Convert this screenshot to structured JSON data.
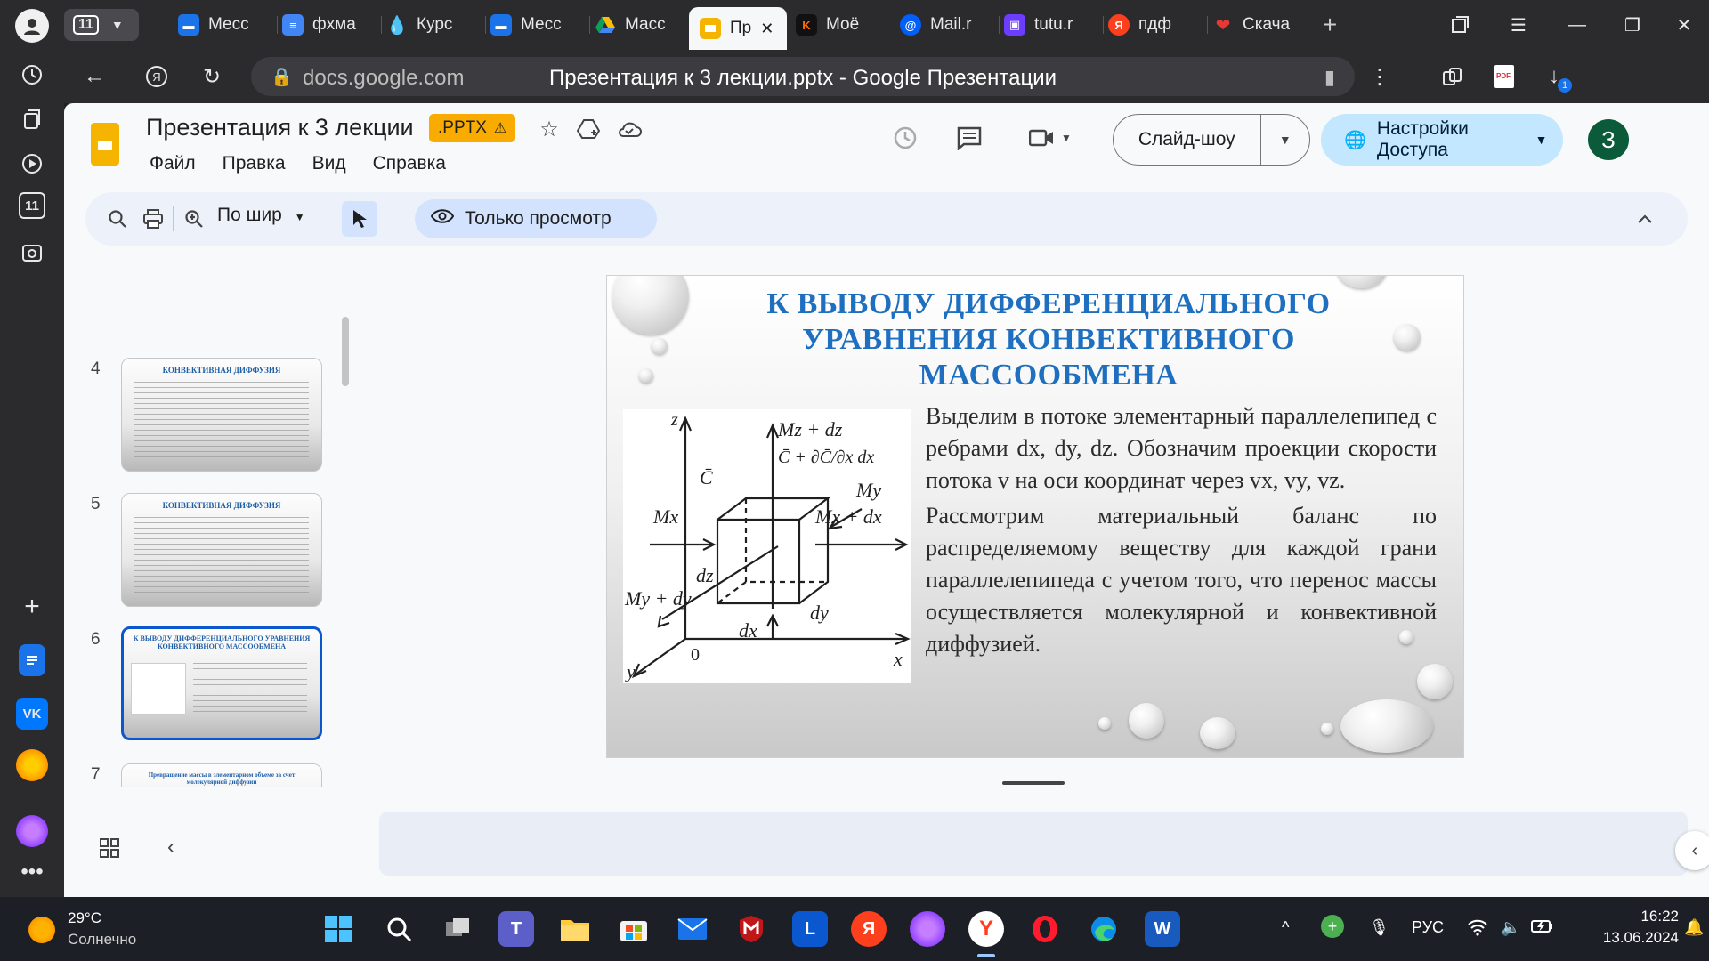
{
  "browser": {
    "tab_count": "11",
    "tabs": [
      {
        "label": "Месс",
        "icon": "messenger-icon",
        "color": "#1a73e8"
      },
      {
        "label": "фхма",
        "icon": "docs-icon",
        "color": "#4285f4"
      },
      {
        "label": "Курс",
        "icon": "drop-icon",
        "color": "#3d5afe"
      },
      {
        "label": "Месс",
        "icon": "messenger-icon",
        "color": "#1a73e8"
      },
      {
        "label": "Масс",
        "icon": "drive-icon",
        "color": "#0f9d58"
      },
      {
        "label": "Пр",
        "icon": "slides-icon",
        "color": "#f4b400"
      },
      {
        "label": "Моё",
        "icon": "k-icon",
        "color": "#ff6d00"
      },
      {
        "label": "Mail.r",
        "icon": "mail-icon",
        "color": "#005ff9"
      },
      {
        "label": "tutu.r",
        "icon": "tutu-icon",
        "color": "#6c3cff"
      },
      {
        "label": "пдф",
        "icon": "yandex-icon",
        "color": "#fc3f1d"
      },
      {
        "label": "Скача",
        "icon": "heart-icon",
        "color": "#e53935"
      }
    ],
    "url": "docs.google.com",
    "page_title": "Презентация к 3 лекции.pptx - Google Презентации",
    "download_badge": "1"
  },
  "docs": {
    "title": "Презентация к 3 лекции",
    "badge": ".PPTX",
    "menu": [
      "Файл",
      "Правка",
      "Вид",
      "Справка"
    ],
    "slideshow_label": "Слайд-шоу",
    "share_label": "Настройки Доступа",
    "account_initial": "З",
    "zoom_label": "По шир",
    "view_only_label": "Только просмотр"
  },
  "filmstrip": [
    {
      "num": "4",
      "title": "КОНВЕКТИВНАЯ ДИФФУЗИЯ",
      "selected": false
    },
    {
      "num": "5",
      "title": "КОНВЕКТИВНАЯ ДИФФУЗИЯ",
      "selected": false
    },
    {
      "num": "6",
      "title": "К ВЫВОДУ ДИФФЕРЕНЦИАЛЬНОГО УРАВНЕНИЯ КОНВЕКТИВНОГО МАССООБМЕНА",
      "selected": true
    },
    {
      "num": "7",
      "title": "Превращение массы в элементарном объеме за счет молекулярной диффузии",
      "selected": false
    }
  ],
  "slide": {
    "title": "К ВЫВОДУ ДИФФЕРЕНЦИАЛЬНОГО УРАВНЕНИЯ КОНВЕКТИВНОГО МАССООБМЕНА",
    "p1": "Выделим в потоке элементарный параллелепипед с ребрами dx, dy, dz. Обозначим проекции скорости потока v на оси координат через vx, vy, vz.",
    "p2": "Рассмотрим материальный баланс по распределяемому веществу для каждой грани параллелепипеда с учетом того, что перенос массы осуществляется молекулярной и конвективной диффузией.",
    "figure": {
      "z": "z",
      "x": "x",
      "y": "y",
      "origin": "0",
      "mz_dz": "Mz + dz",
      "c_grad": "C̄ + ∂C̄/∂x dx",
      "c_bar": "C̄",
      "my": "My",
      "mx": "Mx",
      "mx_dx": "Mx + dx",
      "my_dy": "My + dy",
      "dz": "dz",
      "dy": "dy",
      "dx": "dx"
    }
  },
  "taskbar": {
    "temp": "29°C",
    "weather": "Солнечно",
    "lang": "РУС",
    "time": "16:22",
    "date": "13.06.2024"
  }
}
